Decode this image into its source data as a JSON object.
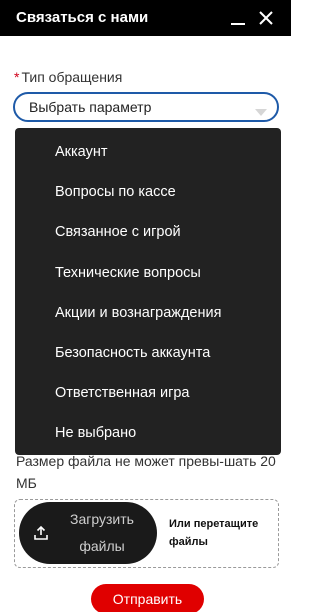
{
  "window": {
    "title": "Связаться с нами"
  },
  "form": {
    "request_type": {
      "required_mark": "*",
      "label": "Тип обращения",
      "selected_value": "Выбрать параметр",
      "options": [
        "Аккаунт",
        "Вопросы по кассе",
        "Связанное с игрой",
        "Технические вопросы",
        "Акции и вознаграждения",
        "Безопасность аккаунта",
        "Ответственная игра",
        "Не выбрано"
      ]
    },
    "file_note": "Размер файла не может превы-шать 20 МБ",
    "upload": {
      "button_label": "Загрузить файлы",
      "drop_hint": "Или перетащите файлы"
    },
    "submit_label": "Отправить"
  },
  "colors": {
    "titlebar": "#000000",
    "select_border": "#1e5aa8",
    "dropdown_bg": "#222222",
    "submit_bg": "#e00000",
    "required": "#d0021b"
  }
}
